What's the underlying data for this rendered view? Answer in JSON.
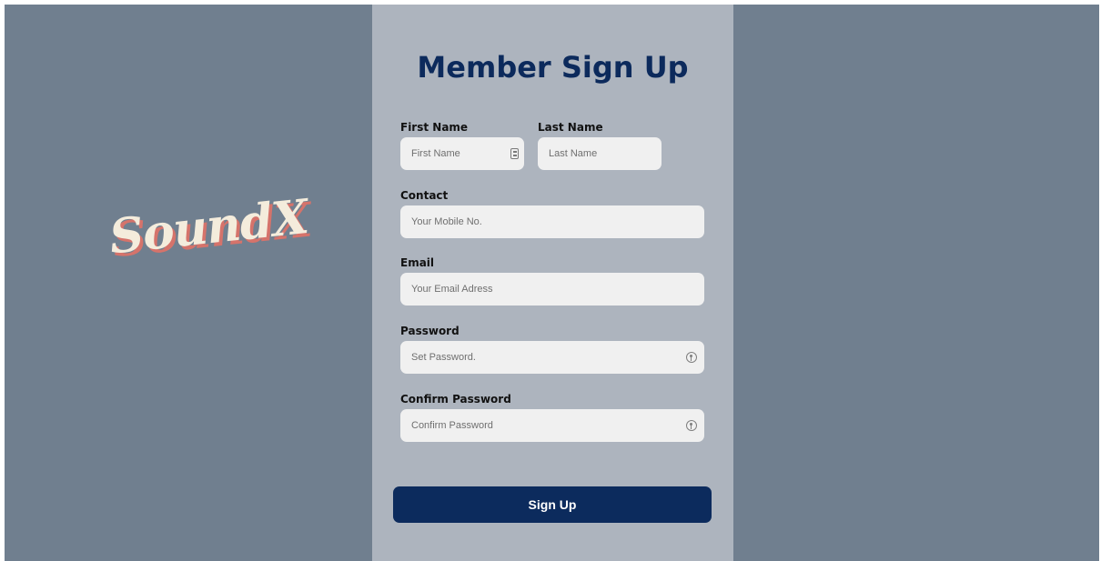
{
  "brand": {
    "logo_text": "SoundX"
  },
  "form": {
    "title": "Member Sign Up",
    "first_name": {
      "label": "First Name",
      "placeholder": "First Name",
      "value": ""
    },
    "last_name": {
      "label": "Last Name",
      "placeholder": "Last Name",
      "value": ""
    },
    "contact": {
      "label": "Contact",
      "placeholder": "Your Mobile No.",
      "value": ""
    },
    "email": {
      "label": "Email",
      "placeholder": "Your Email Adress",
      "value": ""
    },
    "password": {
      "label": "Password",
      "placeholder": "Set Password.",
      "value": ""
    },
    "confirm_password": {
      "label": "Confirm Password",
      "placeholder": "Confirm Password",
      "value": ""
    },
    "submit_label": "Sign Up"
  },
  "colors": {
    "page_background": "#707f8f",
    "panel_background": "#adb4be",
    "input_background": "#f0f0f0",
    "accent_navy": "#0c2b5d",
    "logo_text": "#f4ecdc",
    "logo_shadow": "#d5736b"
  },
  "icons": {
    "first_name_icon": "contact-card-icon",
    "password_icon": "key-icon",
    "confirm_password_icon": "key-icon"
  }
}
